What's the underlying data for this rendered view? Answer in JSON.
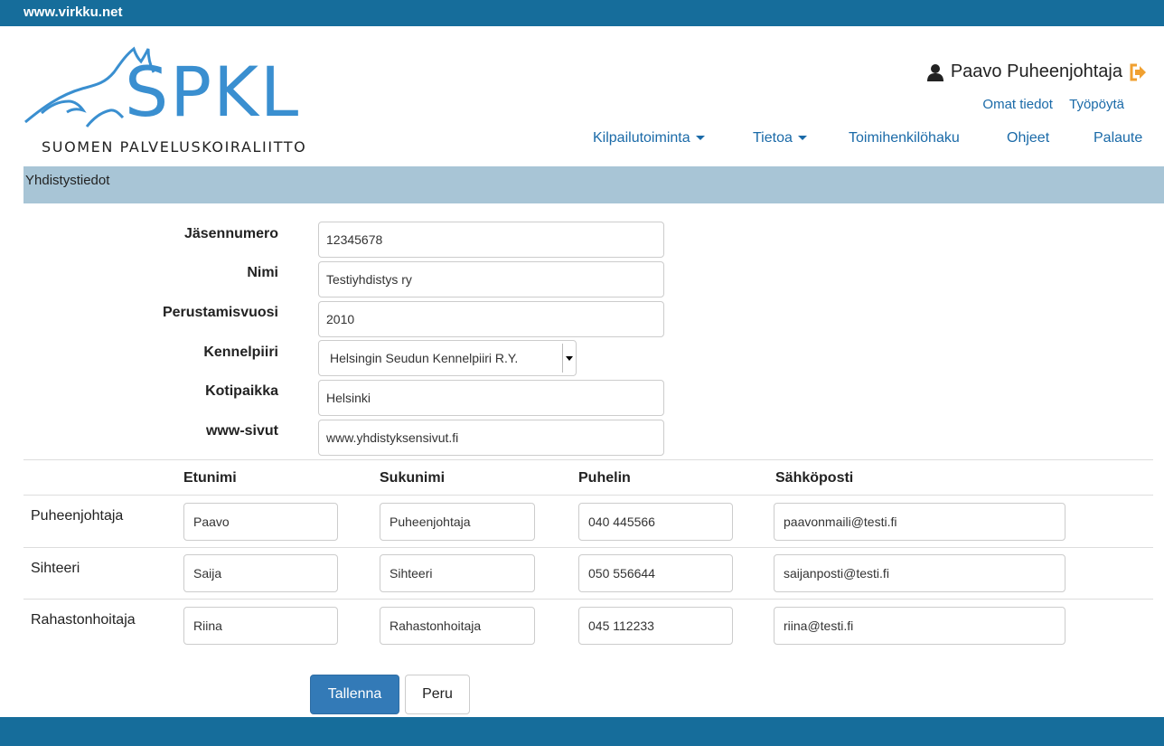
{
  "site": {
    "topbar_link": "www.virkku.net"
  },
  "logo": {
    "wordmark": "SPKL",
    "subtitle": "SUOMEN PALVELUSKOIRALIITTO"
  },
  "user": {
    "name": "Paavo Puheenjohtaja",
    "links": [
      "Omat tiedot",
      "Työpöytä"
    ]
  },
  "nav": {
    "items": [
      "Kilpailutoiminta",
      "Tietoa",
      "Toimihenkilöhaku",
      "Ohjeet",
      "Palaute"
    ]
  },
  "section": {
    "title": "Yhdistystiedot"
  },
  "form": {
    "labels": [
      "Jäsennumero",
      "Nimi",
      "Perustamisvuosi",
      "Kennelpiiri",
      "Kotipaikka",
      "www-sivut"
    ],
    "member_number": "12345678",
    "name": "Testiyhdistys ry",
    "founded": "2010",
    "kennel_district": "Helsingin Seudun Kennelpiiri R.Y.",
    "home_town": "Helsinki",
    "website": "www.yhdistyksensivut.fi"
  },
  "contacts": {
    "headers": [
      "Etunimi",
      "Sukunimi",
      "Puhelin",
      "Sähköposti"
    ],
    "rows": [
      {
        "role": "Puheenjohtaja",
        "first": "Paavo",
        "last": "Puheenjohtaja",
        "phone": "040 445566",
        "email": "paavonmaili@testi.fi"
      },
      {
        "role": "Sihteeri",
        "first": "Saija",
        "last": "Sihteeri",
        "phone": "050 556644",
        "email": "saijanposti@testi.fi"
      },
      {
        "role": "Rahastonhoitaja",
        "first": "Riina",
        "last": "Rahastonhoitaja",
        "phone": "045 112233",
        "email": "riina@testi.fi"
      }
    ]
  },
  "buttons": {
    "save": "Tallenna",
    "cancel": "Peru"
  },
  "colors": {
    "brand_bar": "#166d9b",
    "section_bar": "#a8c5d6",
    "link": "#1a6aa8",
    "primary": "#337ab7",
    "logout_icon": "#f0a030"
  },
  "icons": {
    "user": "user-icon",
    "logout": "logout-icon",
    "dropdown": "caret-down-icon"
  }
}
